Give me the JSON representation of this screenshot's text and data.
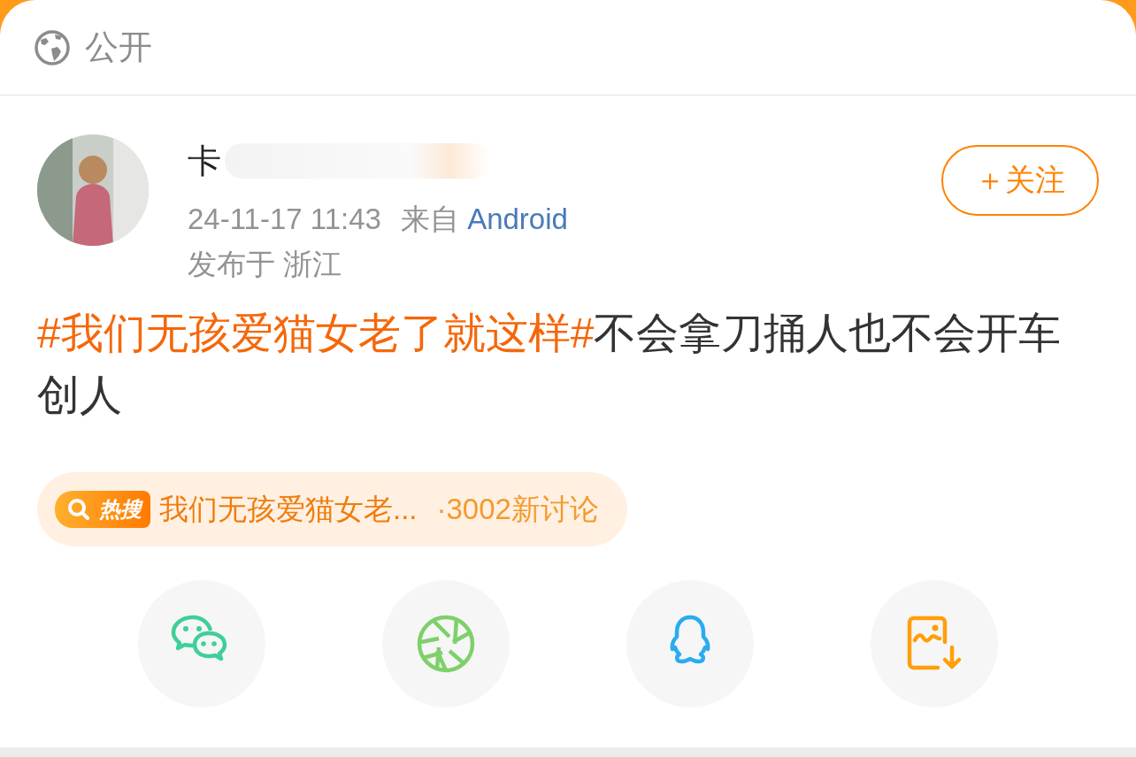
{
  "visibility": {
    "label": "公开"
  },
  "post": {
    "author": {
      "name": "卡"
    },
    "time": "24-11-17 11:43",
    "source_prefix": "来自",
    "source": "Android",
    "location": "发布于 浙江",
    "follow_button": "＋关注",
    "content": [
      {
        "kind": "topic",
        "text": "#我们无孩爱猫女老了就这样#"
      },
      {
        "kind": "plain",
        "text": "不会拿刀捅人也不会开车创人"
      }
    ],
    "hot_search": {
      "badge": "热搜",
      "title": "我们无孩爱猫女老...",
      "count": "·3002新讨论"
    }
  },
  "share_buttons": [
    {
      "kind": "wechat"
    },
    {
      "kind": "moments"
    },
    {
      "kind": "qq"
    },
    {
      "kind": "save-image"
    }
  ]
}
